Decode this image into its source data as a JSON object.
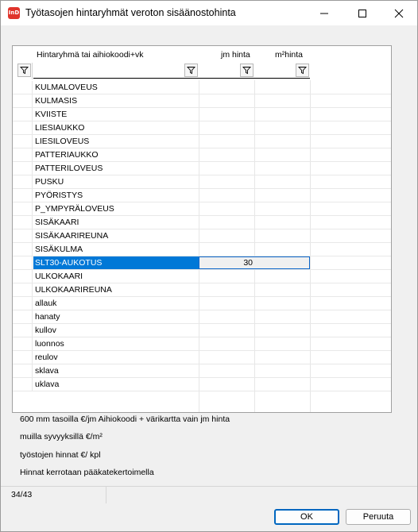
{
  "window": {
    "title": "Työtasojen hintaryhmät veroton sisäänostohinta",
    "app_icon_text": "InD"
  },
  "grid": {
    "columns": [
      "Hintaryhmä tai aihiokoodi+vk",
      "jm hinta",
      "m²hinta"
    ],
    "rows": [
      {
        "name": "KULMALOVEUS",
        "jm": "",
        "m2": ""
      },
      {
        "name": "KULMASIS",
        "jm": "",
        "m2": ""
      },
      {
        "name": "KVIISTE",
        "jm": "",
        "m2": ""
      },
      {
        "name": "LIESIAUKKO",
        "jm": "",
        "m2": ""
      },
      {
        "name": "LIESILOVEUS",
        "jm": "",
        "m2": ""
      },
      {
        "name": "PATTERIAUKKO",
        "jm": "",
        "m2": ""
      },
      {
        "name": "PATTERILOVEUS",
        "jm": "",
        "m2": ""
      },
      {
        "name": "PUSKU",
        "jm": "",
        "m2": ""
      },
      {
        "name": "PYÖRISTYS",
        "jm": "",
        "m2": ""
      },
      {
        "name": "P_YMPYRÄLOVEUS",
        "jm": "",
        "m2": ""
      },
      {
        "name": "SISÄKAARI",
        "jm": "",
        "m2": ""
      },
      {
        "name": "SISÄKAARIREUNA",
        "jm": "",
        "m2": ""
      },
      {
        "name": "SISÄKULMA",
        "jm": "",
        "m2": ""
      },
      {
        "name": "SLT30-AUKOTUS",
        "jm": "30",
        "m2": ""
      },
      {
        "name": "ULKOKAARI",
        "jm": "",
        "m2": ""
      },
      {
        "name": "ULKOKAARIREUNA",
        "jm": "",
        "m2": ""
      },
      {
        "name": "allauk",
        "jm": "",
        "m2": ""
      },
      {
        "name": "hanaty",
        "jm": "",
        "m2": ""
      },
      {
        "name": "kullov",
        "jm": "",
        "m2": ""
      },
      {
        "name": "luonnos",
        "jm": "",
        "m2": ""
      },
      {
        "name": "reulov",
        "jm": "",
        "m2": ""
      },
      {
        "name": "sklava",
        "jm": "",
        "m2": ""
      },
      {
        "name": "uklava",
        "jm": "",
        "m2": ""
      }
    ],
    "selected_row": 13,
    "scroll": {
      "position": 0.56,
      "visible_fraction": 0.44
    }
  },
  "info_lines": [
    "600 mm tasoilla €/jm   Aihiokoodi + värikartta vain jm hinta",
    "muilla syvyyksillä €/m²",
    "työstojen hinnat €/ kpl",
    "Hinnat kerrotaan pääkatekertoimella"
  ],
  "status": {
    "record": "34/43"
  },
  "buttons": {
    "ok": "OK",
    "cancel": "Peruuta"
  },
  "colors": {
    "selection": "#0078d7",
    "app_icon": "#e0342b"
  }
}
